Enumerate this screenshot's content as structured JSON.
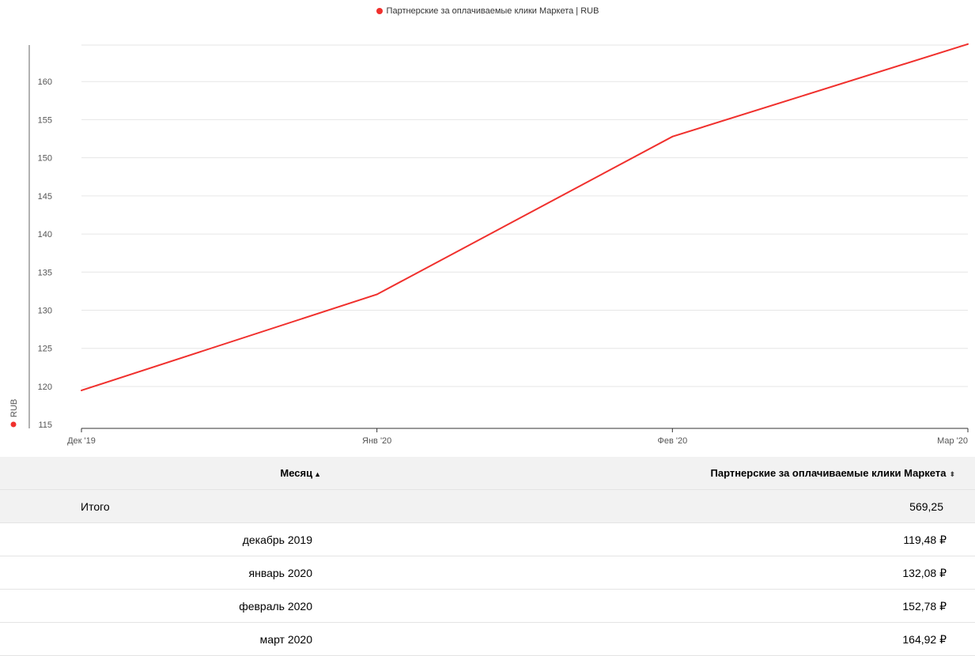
{
  "legend": {
    "label": "Партнерские за оплачиваемые клики Маркета | RUB",
    "color": "#f0302d"
  },
  "chart_data": {
    "type": "line",
    "categories": [
      "Дек '19",
      "Янв '20",
      "Фев '20",
      "Мар '20"
    ],
    "series": [
      {
        "name": "Партнерские за оплачиваемые клики Маркета | RUB",
        "values": [
          119.48,
          132.08,
          152.78,
          164.92
        ],
        "color": "#f0302d"
      }
    ],
    "ylabel": "RUB",
    "yticks": [
      115,
      120,
      125,
      130,
      135,
      140,
      145,
      150,
      155,
      160
    ],
    "ylim": [
      114.5,
      165
    ],
    "grid": true
  },
  "table": {
    "headers": {
      "month": "Месяц",
      "month_sort_icon": "sort-ascending-icon",
      "value": "Партнерские за оплачиваемые клики Маркета",
      "value_sort_icon": "sort-both-icon"
    },
    "total": {
      "label": "Итого",
      "value": "569,25"
    },
    "rows": [
      {
        "month": "декабрь 2019",
        "value": "119,48 ₽"
      },
      {
        "month": "январь 2020",
        "value": "132,08 ₽"
      },
      {
        "month": "февраль 2020",
        "value": "152,78 ₽"
      },
      {
        "month": "март 2020",
        "value": "164,92 ₽"
      }
    ]
  }
}
